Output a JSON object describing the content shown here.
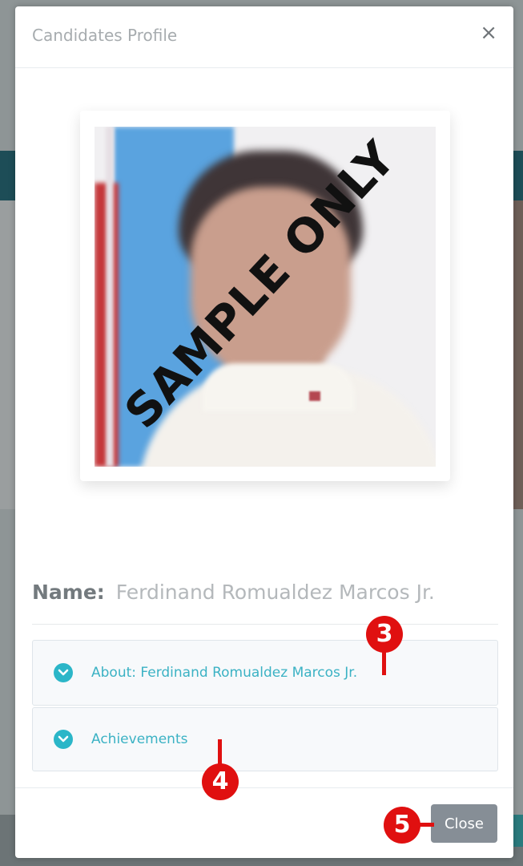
{
  "modal": {
    "title": "Candidates Profile",
    "close_icon": "×",
    "watermark": "SAMPLE ONLY",
    "name_label": "Name:",
    "name_value": "Ferdinand Romualdez Marcos Jr.",
    "accordion": [
      {
        "label": "About: Ferdinand Romualdez Marcos Jr.",
        "icon": "chevron-down-circle-icon"
      },
      {
        "label": "Achievements",
        "icon": "chevron-down-circle-icon"
      }
    ],
    "close_button": "Close"
  },
  "annotations": [
    "3",
    "4",
    "5"
  ],
  "colors": {
    "accent": "#2bb6c8",
    "close_button": "#868e96",
    "callout": "#e01010"
  }
}
